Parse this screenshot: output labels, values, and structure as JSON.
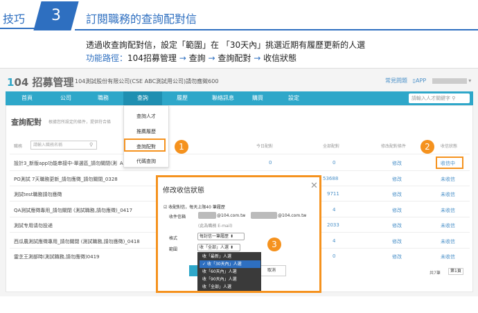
{
  "tip": {
    "tag": "技巧",
    "number": "3",
    "title": "訂閱職務的查詢配對信",
    "desc_line1": "透過收查詢配對信，設定「範圍」在 「30天內」挑選近期有履歷更新的人選",
    "path_label": "功能路徑：",
    "path_parts": [
      "104招募管理",
      "→",
      "查詢",
      "→",
      "查詢配對",
      "→",
      "收信狀態"
    ]
  },
  "app": {
    "brand_prefix": "1",
    "brand_rest": "04 招募管理",
    "company": "104測試股份有限公司(CSE ABC測試用公司)請勿應徵600",
    "top_links": [
      "常見問題",
      "APP"
    ],
    "nav": [
      "首頁",
      "公司",
      "職務",
      "查詢",
      "履歷",
      "聯絡訊息",
      "購買",
      "設定"
    ],
    "nav_search_placeholder": "請輸入人才關鍵字",
    "page_title": "查詢配對",
    "page_sub": "根據您所設定的條件，提供符合條",
    "menu_items": [
      "查詢人才",
      "推薦履歷",
      "查詢配對",
      "代碼查詢"
    ],
    "table": {
      "col_job": "職務",
      "search_placeholder": "請輸入職務名稱",
      "col_today": "今日配對",
      "col_all": "全部配對",
      "col_edit": "修改配對條件",
      "col_status": "收信狀態",
      "rows": [
        {
          "job": "設計3_新版app功能串接中-單選區_請勿關閉(測",
          "extra": "A",
          "today": "0",
          "all": "0",
          "edit": "修改",
          "status": "收信中"
        },
        {
          "job": "PO測試 7天職務更新_請勿應徵_請勿關閉_0328",
          "extra": "",
          "today": "",
          "all": "53688",
          "edit": "修改",
          "status": "未收信"
        },
        {
          "job": "測試test職務請勿應徵",
          "extra": "",
          "today": "",
          "all": "9711",
          "edit": "修改",
          "status": "未收信"
        },
        {
          "job": "QA測試應徵專用_請勿關閉 (測試職務,請勿應徵)_0417",
          "extra": "",
          "today": "",
          "all": "4",
          "edit": "修改",
          "status": "未收信"
        },
        {
          "job": "測試专用请勿投递",
          "extra": "",
          "today": "",
          "all": "2033",
          "edit": "修改",
          "status": "未收信"
        },
        {
          "job": "西瓜農測試應徵專用_請勿關閉 (測試職務,請勿應徵)_0418",
          "extra": "",
          "today": "",
          "all": "4",
          "edit": "修改",
          "status": "未收信"
        },
        {
          "job": "靈芝王測部時(測試職務,請勿應徵)0419",
          "extra": "",
          "today": "",
          "all": "0",
          "edit": "修改",
          "status": "未收信"
        }
      ],
      "pager_text": "共7筆",
      "pager_value": "第1頁"
    },
    "badges": [
      "1",
      "2",
      "3"
    ]
  },
  "modal": {
    "title": "修改收信狀態",
    "close": "✕",
    "checkbox_label": "收配對信，每天上限40 筆履歷",
    "recipient_label": "收件信箱",
    "email1_suffix": "@104.com.tw",
    "email2_suffix": "@104.com.tw",
    "email_note": "(此為職務 E-mail)",
    "format_label": "格式",
    "format_value": "每封信一筆履歷",
    "range_label": "範圍",
    "range_value": "收「全部」人選",
    "range_options": [
      "收「最新」人選",
      "收「30天內」人選",
      "收「60天內」人選",
      "收「90天內」人選",
      "收「全部」人選"
    ],
    "range_selected_index": 1,
    "cancel_label": "取消"
  },
  "colors": {
    "accent_blue": "#2e6fc0",
    "nav_teal": "#2ea7c9",
    "highlight_orange": "#f5921e"
  }
}
